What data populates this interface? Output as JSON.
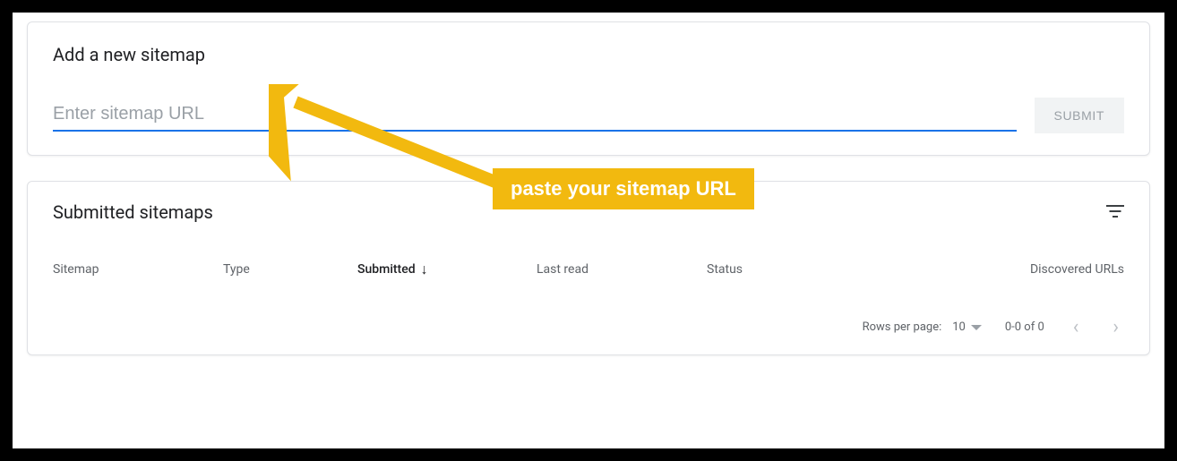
{
  "add_card": {
    "title": "Add a new sitemap",
    "input_placeholder": "Enter sitemap URL",
    "submit_label": "SUBMIT"
  },
  "annotation": {
    "text": "paste your sitemap URL"
  },
  "submitted_card": {
    "title": "Submitted sitemaps",
    "columns": {
      "sitemap": "Sitemap",
      "type": "Type",
      "submitted": "Submitted",
      "last_read": "Last read",
      "status": "Status",
      "discovered_urls": "Discovered URLs"
    },
    "pager": {
      "rows_per_page_label": "Rows per page:",
      "rows_per_page_value": "10",
      "range": "0-0 of 0"
    }
  }
}
